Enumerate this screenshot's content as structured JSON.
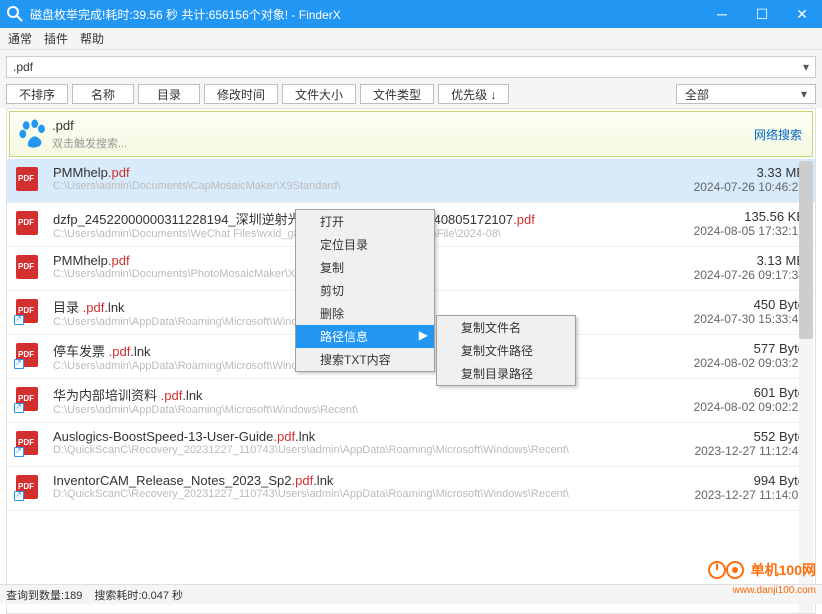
{
  "window": {
    "title": "磁盘枚举完成!耗时:39.56 秒 共计:656156个对象!  - FinderX"
  },
  "menubar": [
    "通常",
    "插件",
    "帮助"
  ],
  "search": {
    "value": ".pdf"
  },
  "toolbar": [
    "不排序",
    "名称",
    "目录",
    "修改时间",
    "文件大小",
    "文件类型",
    "优先级 ↓"
  ],
  "filter": {
    "label": "全部"
  },
  "websearch": {
    "query": ".pdf",
    "hint": "双击触发搜索...",
    "link": "网络搜索"
  },
  "files": [
    {
      "name": "PMMhelp",
      "ext": ".pdf",
      "lnk": false,
      "size": "3.33 MB",
      "date": "2024-07-26 10:46:25",
      "path": "C:\\Users\\admin\\Documents\\CapMosaicMaker\\X9Standard\\"
    },
    {
      "name": "dzfp_24522000000311228194_深圳逆射光通信技术有限公司_20240805172107",
      "ext": ".pdf",
      "lnk": false,
      "size": "135.56 KB",
      "date": "2024-08-05 17:32:18",
      "path": "C:\\Users\\admin\\Documents\\WeChat Files\\wxid_g8anp0wmuvyr22\\FileStorage\\File\\2024-08\\"
    },
    {
      "name": "PMMhelp",
      "ext": ".pdf",
      "lnk": false,
      "size": "3.13 MB",
      "date": "2024-07-26 09:17:34",
      "path": "C:\\Users\\admin\\Documents\\PhotoMosaicMaker\\X9Standard\\"
    },
    {
      "name": "目录 ",
      "ext": ".pdf",
      "suffix": ".lnk",
      "lnk": true,
      "size": "450 Byte",
      "date": "2024-07-30 15:33:43",
      "path": "C:\\Users\\admin\\AppData\\Roaming\\Microsoft\\Windows\\Recent\\"
    },
    {
      "name": "停车发票 ",
      "ext": ".pdf",
      "suffix": ".lnk",
      "lnk": true,
      "size": "577 Byte",
      "date": "2024-08-02 09:03:20",
      "path": "C:\\Users\\admin\\AppData\\Roaming\\Microsoft\\Windows\\Recent\\"
    },
    {
      "name": "华为内部培训资料 ",
      "ext": ".pdf",
      "suffix": ".lnk",
      "lnk": true,
      "size": "601 Byte",
      "date": "2024-08-02 09:02:23",
      "path": "C:\\Users\\admin\\AppData\\Roaming\\Microsoft\\Windows\\Recent\\"
    },
    {
      "name": "Auslogics-BoostSpeed-13-User-Guide",
      "ext": ".pdf",
      "suffix": ".lnk",
      "lnk": true,
      "size": "552 Byte",
      "date": "2023-12-27 11:12:49",
      "path": "D:\\QuickScanC\\Recovery_20231227_110743\\Users\\admin\\AppData\\Roaming\\Microsoft\\Windows\\Recent\\"
    },
    {
      "name": "InventorCAM_Release_Notes_2023_Sp2",
      "ext": ".pdf",
      "suffix": ".lnk",
      "lnk": true,
      "size": "994 Byte",
      "date": "2023-12-27 11:14:07",
      "path": "D:\\QuickScanC\\Recovery_20231227_110743\\Users\\admin\\AppData\\Roaming\\Microsoft\\Windows\\Recent\\"
    }
  ],
  "context_menu1": [
    "打开",
    "定位目录",
    "复制",
    "剪切",
    "删除",
    "路径信息",
    "搜索TXT内容"
  ],
  "context_menu2": [
    "复制文件名",
    "复制文件路径",
    "复制目录路径"
  ],
  "statusbar": {
    "count_label": "查询到数量:189",
    "time_label": "搜索耗时:0.047 秒"
  },
  "watermark": {
    "text": "单机100网",
    "url": "www.danji100.com"
  }
}
